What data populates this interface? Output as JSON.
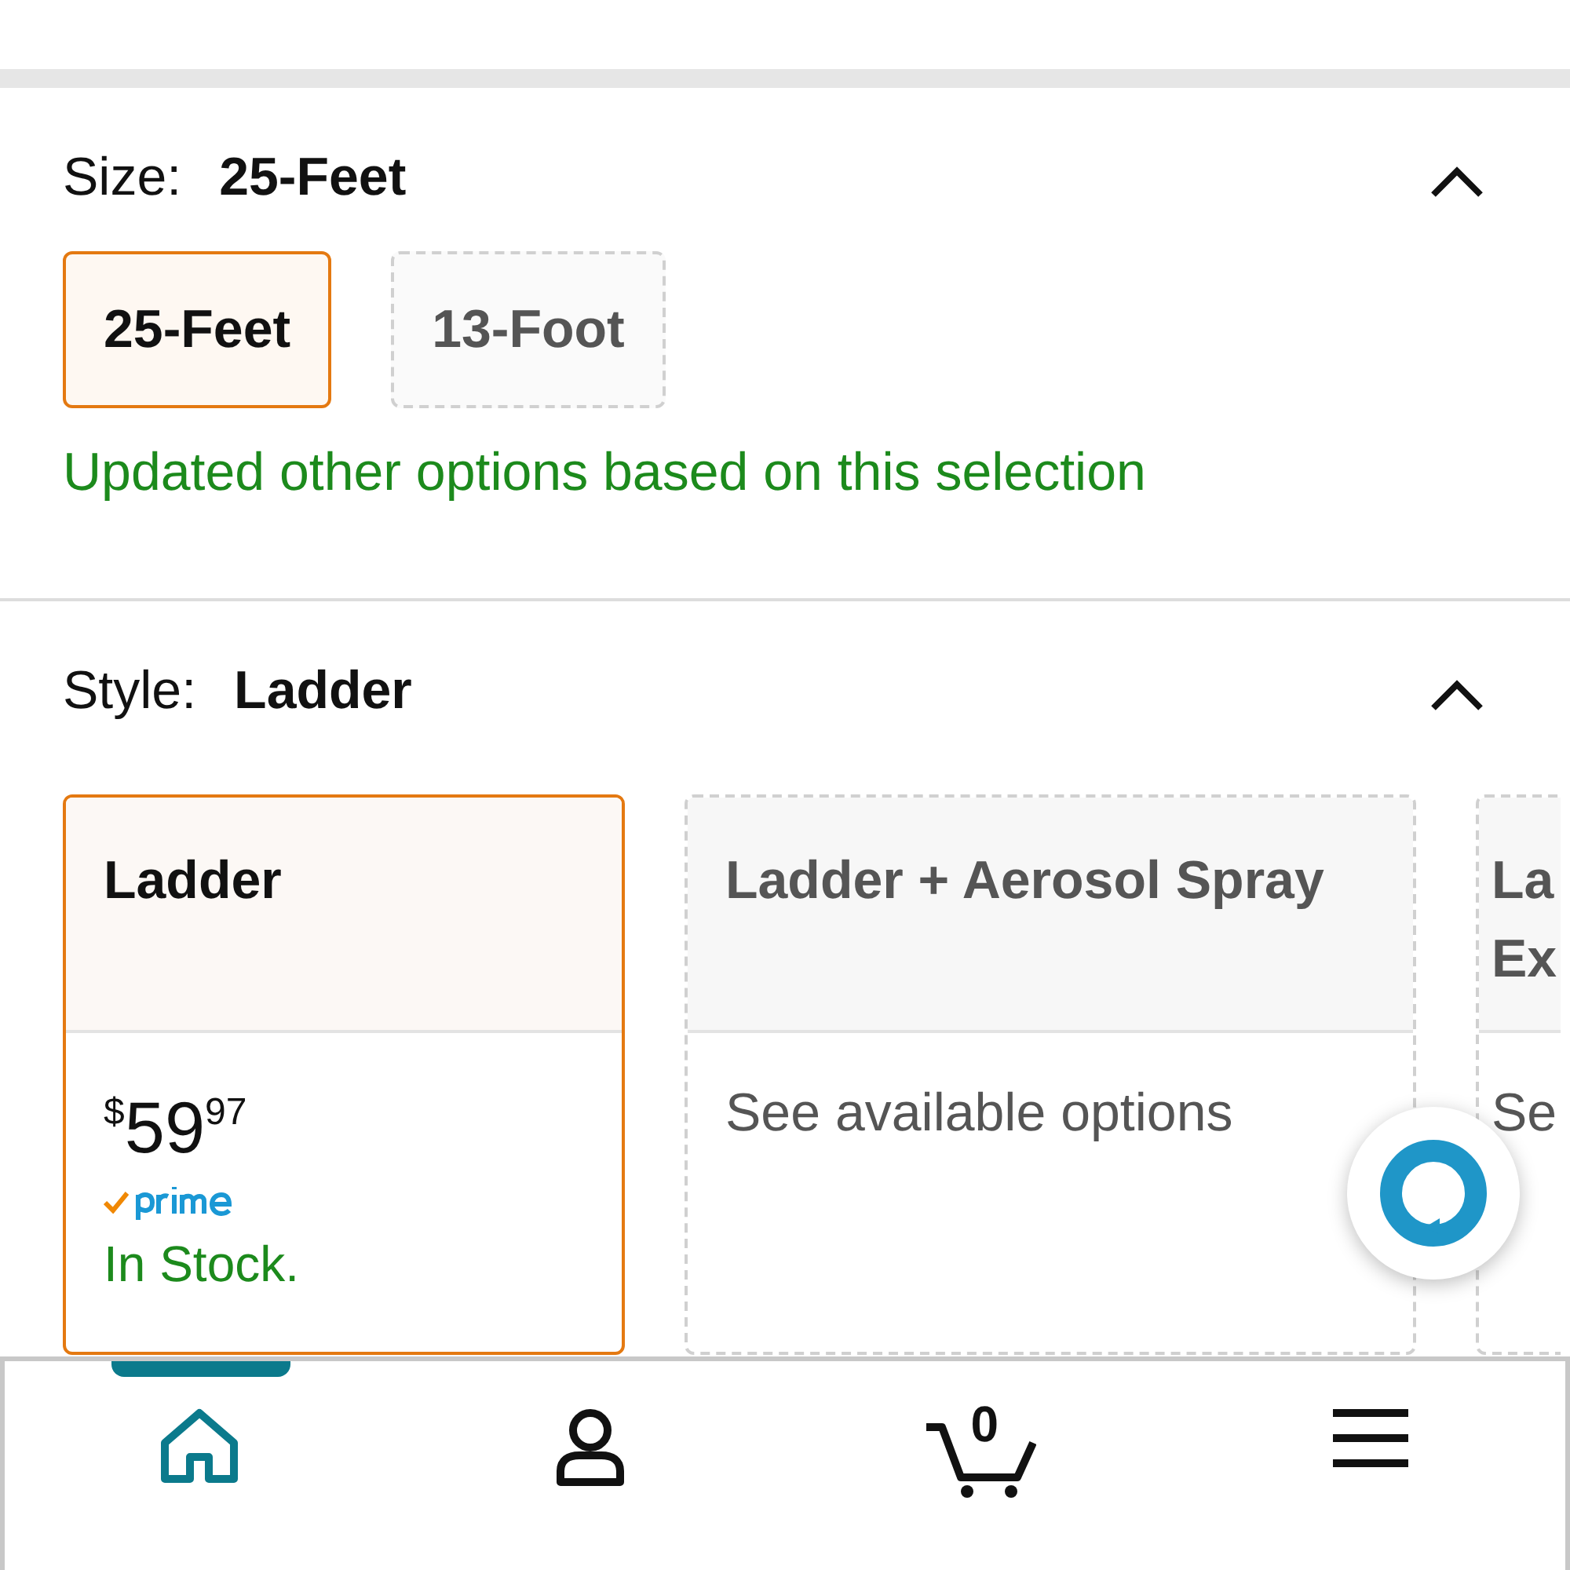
{
  "sections": [
    {
      "label": "Size:",
      "value": "25-Feet",
      "expanded": true,
      "kind": "chips",
      "options": [
        {
          "label": "25-Feet",
          "selected": true,
          "available": true
        },
        {
          "label": "13-Foot",
          "selected": false,
          "available": false
        }
      ],
      "note": "Updated other options based on this selection"
    },
    {
      "label": "Style:",
      "value": "Ladder",
      "expanded": true,
      "kind": "cards",
      "options": [
        {
          "title": "Ladder",
          "selected": true,
          "available": true,
          "cut_off": false,
          "price_symbol": "$",
          "price_whole": "59",
          "price_fraction": "97",
          "prime": true,
          "stock": "In Stock."
        },
        {
          "title": "Ladder + Aerosol Spray",
          "selected": false,
          "available": false,
          "cut_off": false,
          "info": "See available options"
        },
        {
          "title": "La Ex",
          "selected": false,
          "available": false,
          "cut_off": true,
          "info": "Se"
        }
      ]
    }
  ],
  "cart_count": "0",
  "nav": [
    {
      "kind": "home",
      "selected": true
    },
    {
      "kind": "account",
      "selected": false
    },
    {
      "kind": "cart",
      "selected": false
    },
    {
      "kind": "menu",
      "selected": false
    }
  ]
}
